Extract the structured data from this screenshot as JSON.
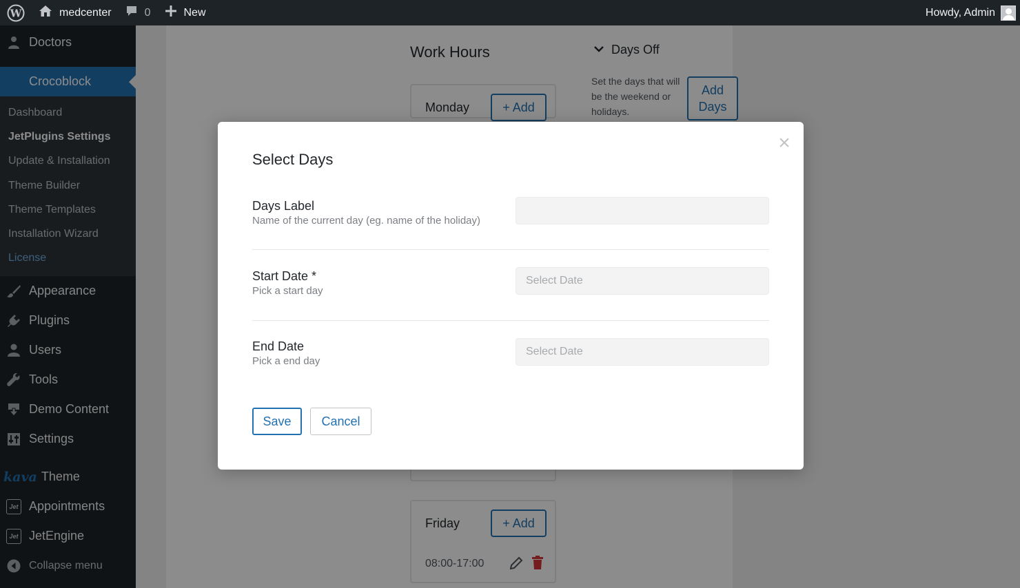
{
  "adminbar": {
    "site_name": "medcenter",
    "comments_count": "0",
    "new_label": "New",
    "greeting": "Howdy, Admin"
  },
  "sidebar": {
    "top_item": "Doctors",
    "active_item": "Crocoblock",
    "submenu": [
      "Dashboard",
      "JetPlugins Settings",
      "Update & Installation",
      "Theme Builder",
      "Theme Templates",
      "Installation Wizard",
      "License"
    ],
    "items": [
      {
        "label": "Appearance",
        "icon": "paintbrush-icon"
      },
      {
        "label": "Plugins",
        "icon": "plugin-icon"
      },
      {
        "label": "Users",
        "icon": "users-icon"
      },
      {
        "label": "Tools",
        "icon": "wrench-icon"
      },
      {
        "label": "Demo Content",
        "icon": "download-icon"
      },
      {
        "label": "Settings",
        "icon": "settings-icon"
      }
    ],
    "kava_logo": "kava",
    "theme_label": "Theme",
    "appointments_label": "Appointments",
    "jetengine_label": "JetEngine",
    "jet_badge": "Jet",
    "collapse_label": "Collapse menu"
  },
  "background": {
    "work_hours_title": "Work Hours",
    "monday": "Monday",
    "friday": "Friday",
    "add_label": "+ Add",
    "friday_slot": "08:00-17:00",
    "days_off_title": "Days Off",
    "days_off_desc": "Set the days that will be the weekend or holidays.",
    "add_days_line1": "Add",
    "add_days_line2": "Days"
  },
  "modal": {
    "title": "Select Days",
    "close_glyph": "×",
    "fields": [
      {
        "label": "Days Label",
        "desc": "Name of the current day (eg. name of the holiday)",
        "value": "",
        "placeholder": ""
      },
      {
        "label": "Start Date *",
        "desc": "Pick a start day",
        "value": "",
        "placeholder": "Select Date"
      },
      {
        "label": "End Date",
        "desc": "Pick a end day",
        "value": "",
        "placeholder": "Select Date"
      }
    ],
    "save_label": "Save",
    "cancel_label": "Cancel"
  },
  "colors": {
    "accent": "#2271b1",
    "sidebar_bg": "#1d2327",
    "delete_red": "#d63638"
  }
}
